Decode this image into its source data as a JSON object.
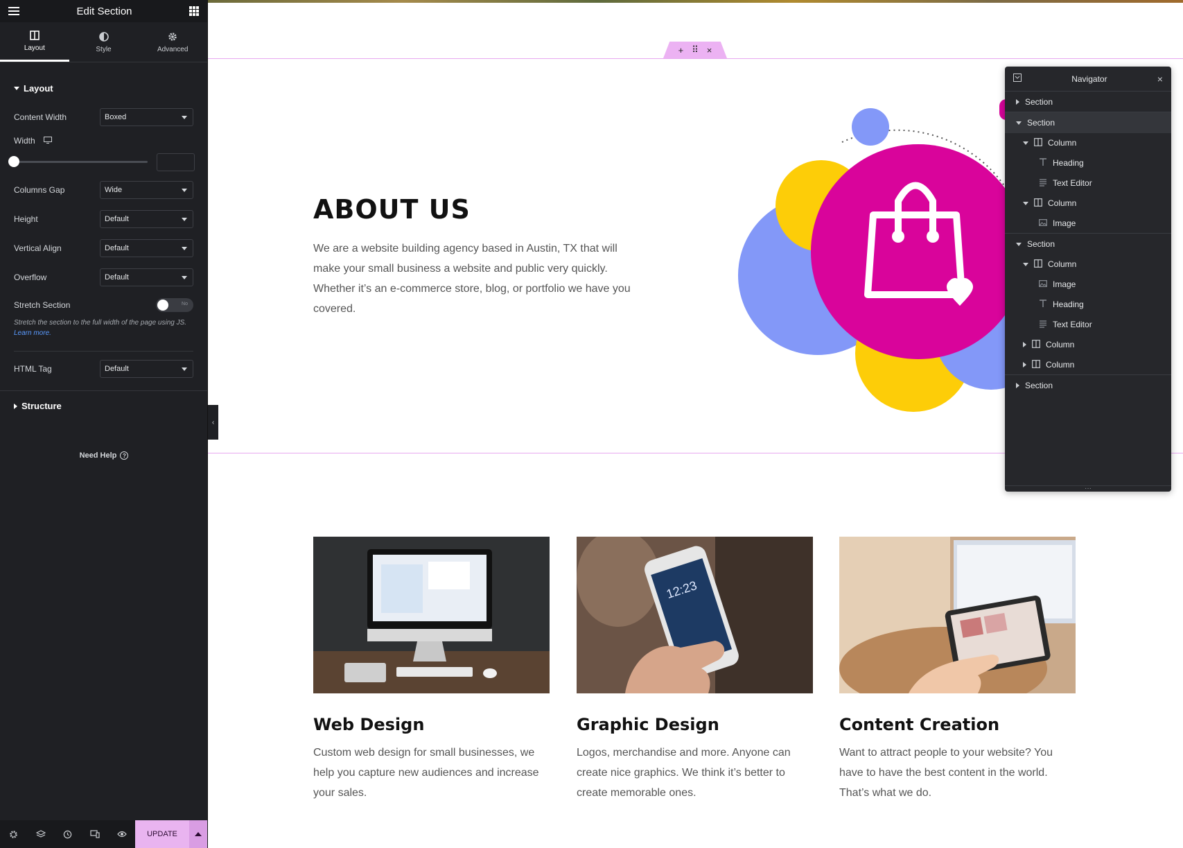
{
  "panel": {
    "title": "Edit Section",
    "tabs": [
      {
        "label": "Layout",
        "icon": "columns-icon"
      },
      {
        "label": "Style",
        "icon": "half-circle-icon"
      },
      {
        "label": "Advanced",
        "icon": "gear-icon"
      }
    ],
    "layout_section": "Layout",
    "content_width": {
      "label": "Content Width",
      "value": "Boxed"
    },
    "width": {
      "label": "Width",
      "icon": "desktop-icon",
      "value": 0
    },
    "columns_gap": {
      "label": "Columns Gap",
      "value": "Wide"
    },
    "height": {
      "label": "Height",
      "value": "Default"
    },
    "vertical_align": {
      "label": "Vertical Align",
      "value": "Default"
    },
    "overflow": {
      "label": "Overflow",
      "value": "Default"
    },
    "stretch_section": {
      "label": "Stretch Section",
      "toggle_text": "No",
      "enabled": false
    },
    "stretch_desc": "Stretch the section to the full width of the page using JS.",
    "learn_more": "Learn more.",
    "html_tag": {
      "label": "HTML Tag",
      "value": "Default"
    },
    "structure_section": "Structure",
    "need_help": "Need Help",
    "footer": {
      "update_label": "UPDATE",
      "icons": [
        "settings-icon",
        "layers-icon",
        "history-icon",
        "responsive-icon",
        "preview-eye-icon"
      ]
    }
  },
  "canvas": {
    "section_handle_icons": [
      "add-icon",
      "drag-handle-icon",
      "close-icon"
    ],
    "about": {
      "title": "ABOUT US",
      "text": "We are a website building agency based in Austin, TX that will make your small business a website and public very quickly. Whether it’s an e-commerce store, blog, or portfolio we have you covered."
    },
    "cards": [
      {
        "title": "Web Design",
        "text": "Custom web design for small businesses, we help you capture new audiences and increase your sales."
      },
      {
        "title": "Graphic Design",
        "text": "Logos, merchandise and more. Anyone can create nice graphics. We think it’s better to create memorable ones."
      },
      {
        "title": "Content Creation",
        "text": "Want to attract people to your website? You have to have the best content in the world. That’s what we do."
      }
    ]
  },
  "navigator": {
    "title": "Navigator",
    "items": [
      {
        "label": "Section",
        "type": "section",
        "expanded": false
      },
      {
        "label": "Section",
        "type": "section",
        "expanded": true,
        "active": true
      },
      {
        "label": "Column",
        "type": "column",
        "expanded": true
      },
      {
        "label": "Heading",
        "type": "heading"
      },
      {
        "label": "Text Editor",
        "type": "text-editor"
      },
      {
        "label": "Column",
        "type": "column",
        "expanded": true
      },
      {
        "label": "Image",
        "type": "image"
      },
      {
        "label": "Section",
        "type": "section",
        "expanded": true
      },
      {
        "label": "Column",
        "type": "column",
        "expanded": true
      },
      {
        "label": "Image",
        "type": "image"
      },
      {
        "label": "Heading",
        "type": "heading"
      },
      {
        "label": "Text Editor",
        "type": "text-editor"
      },
      {
        "label": "Column",
        "type": "column",
        "expanded": false
      },
      {
        "label": "Column",
        "type": "column",
        "expanded": false
      },
      {
        "label": "Section",
        "type": "section",
        "expanded": false
      }
    ]
  },
  "colors": {
    "panel_bg": "#1f2024",
    "accent_pink": "#e9b4f0",
    "magenta": "#d9049b",
    "yellow": "#fdcd08",
    "periwinkle": "#8398f8"
  }
}
